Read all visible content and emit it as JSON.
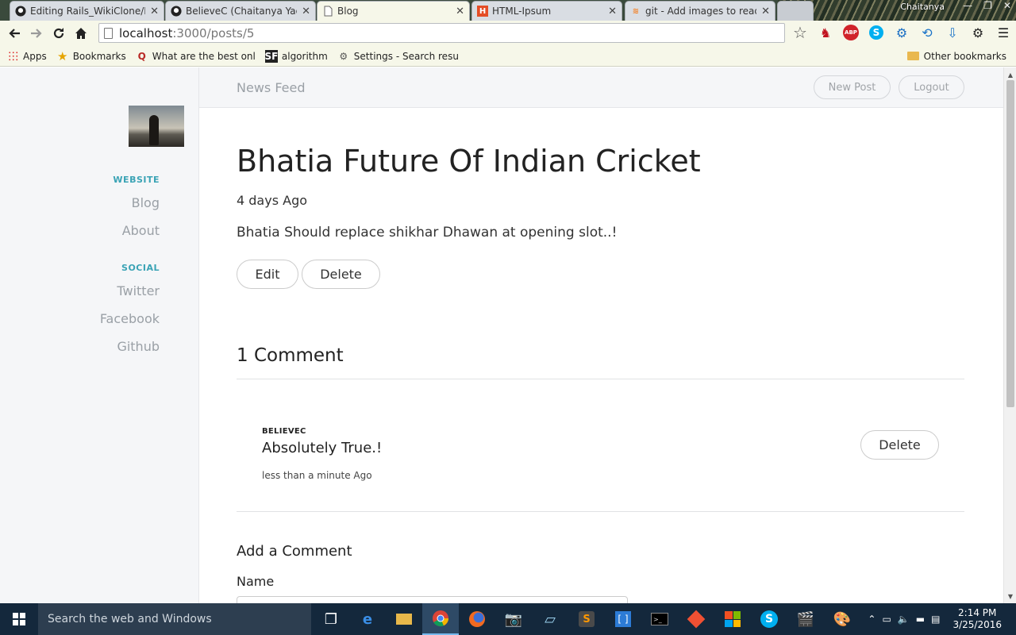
{
  "browser": {
    "tabs": [
      {
        "title": "Editing Rails_WikiClone/RI",
        "icon": "github-icon",
        "active": false
      },
      {
        "title": "BelieveC (Chaitanya Yadav",
        "icon": "github-icon",
        "active": false
      },
      {
        "title": "Blog",
        "icon": "page-icon",
        "active": true
      },
      {
        "title": "HTML-Ipsum",
        "icon": "html-ipsum-icon",
        "active": false
      },
      {
        "title": "git - Add images to readm",
        "icon": "stackoverflow-icon",
        "active": false
      }
    ],
    "profile_name": "Chaitanya",
    "url_host": "localhost",
    "url_path": ":3000/posts/5",
    "bookmarks": [
      {
        "label": "Apps",
        "icon": "apps-grid-icon"
      },
      {
        "label": "Bookmarks",
        "icon": "star-icon"
      },
      {
        "label": "What are the best onl",
        "icon": "quora-icon"
      },
      {
        "label": "algorithm",
        "icon": "sf-icon"
      },
      {
        "label": "Settings - Search resu",
        "icon": "gear-icon"
      }
    ],
    "other_bookmarks": "Other bookmarks",
    "abp_label": "ABP"
  },
  "sidebar": {
    "website_heading": "WEBSITE",
    "website_links": [
      "Blog",
      "About"
    ],
    "social_heading": "SOCIAL",
    "social_links": [
      "Twitter",
      "Facebook",
      "Github"
    ]
  },
  "topbar": {
    "news_feed": "News Feed",
    "new_post": "New Post",
    "logout": "Logout"
  },
  "post": {
    "title": "Bhatia Future Of Indian Cricket",
    "date": "4 days Ago",
    "body": "Bhatia Should replace shikhar Dhawan at opening slot..!",
    "edit_label": "Edit",
    "delete_label": "Delete"
  },
  "comments": {
    "heading": "1 Comment",
    "items": [
      {
        "author": "BELIEVEC",
        "body": "Absolutely True.!",
        "time": "less than a minute Ago",
        "delete_label": "Delete"
      }
    ]
  },
  "form": {
    "heading": "Add a Comment",
    "name_label": "Name",
    "name_value": ""
  },
  "taskbar": {
    "search_placeholder": "Search the web and Windows",
    "time": "2:14 PM",
    "date": "3/25/2016"
  },
  "colors": {
    "accent": "#3aa3b5",
    "sidebar_bg": "#f5f6f8",
    "taskbar_bg": "#14283c"
  }
}
